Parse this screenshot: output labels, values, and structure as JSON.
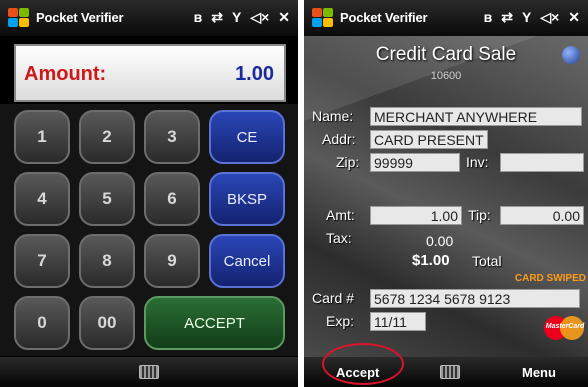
{
  "left": {
    "status": {
      "title": "Pocket Verifier",
      "icons": [
        "bluetooth-icon",
        "sync-icon",
        "signal-icon",
        "volume-mute-icon",
        "close-icon"
      ]
    },
    "amount": {
      "label": "Amount:",
      "value": "1.00"
    },
    "keys": {
      "k1": "1",
      "k2": "2",
      "k3": "3",
      "ce": "CE",
      "k4": "4",
      "k5": "5",
      "k6": "6",
      "bksp": "BKSP",
      "k7": "7",
      "k8": "8",
      "k9": "9",
      "cancel": "Cancel",
      "k0": "0",
      "k00": "00",
      "accept": "ACCEPT"
    }
  },
  "right": {
    "status": {
      "title": "Pocket Verifier"
    },
    "title": "Credit Card Sale",
    "subtitle": "10600",
    "labels": {
      "name": "Name:",
      "addr": "Addr:",
      "zip": "Zip:",
      "inv": "Inv:",
      "amt": "Amt:",
      "tip": "Tip:",
      "tax": "Tax:",
      "total": "Total",
      "card": "Card #",
      "exp": "Exp:"
    },
    "values": {
      "name": "MERCHANT ANYWHERE",
      "addr": "CARD PRESENT",
      "zip": "99999",
      "inv": "",
      "amt": "1.00",
      "tip": "0.00",
      "tax": "0.00",
      "total": "$1.00",
      "card": "5678 1234 5678 9123",
      "exp": "11/11"
    },
    "swiped": "CARD SWIPED",
    "mastercard": "MasterCard",
    "softkeys": {
      "accept": "Accept",
      "menu": "Menu"
    }
  },
  "colors": {
    "amount_label": "#d01818",
    "amount_value": "#1b2c9a",
    "swiped": "#ff9a1a",
    "circle": "#d8152a"
  }
}
